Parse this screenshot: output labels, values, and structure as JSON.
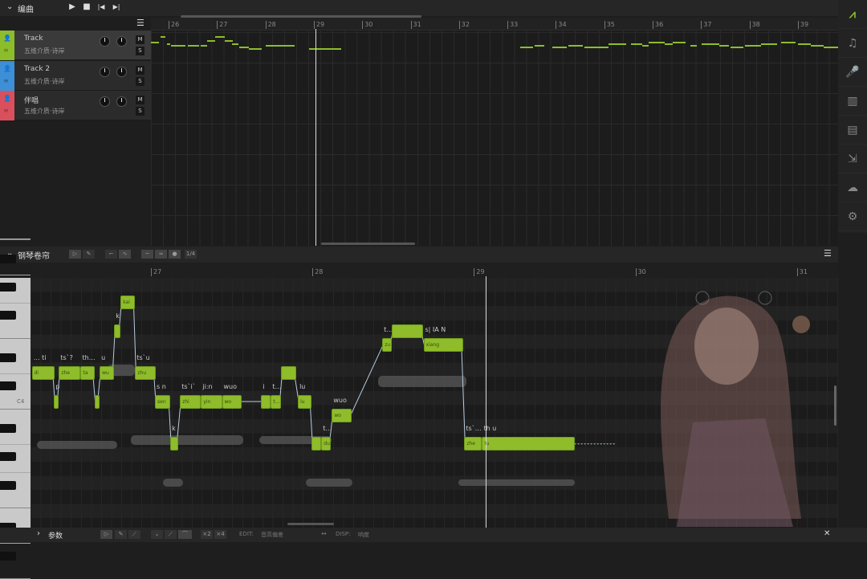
{
  "arrange": {
    "title": "编曲",
    "transport": [
      "▶",
      "■",
      "|◀",
      "▶|"
    ],
    "menu": "☰",
    "ruler": [
      "26",
      "27",
      "28",
      "29",
      "30",
      "31",
      "32",
      "33",
      "34",
      "35",
      "36",
      "37",
      "38",
      "39"
    ],
    "tracks": [
      {
        "name": "Track",
        "singer": "五维介质·诗岸",
        "color": "#8cbd2b",
        "mute": "M",
        "solo": "S"
      },
      {
        "name": "Track 2",
        "singer": "五维介质·诗岸",
        "color": "#3d8fd6",
        "mute": "M",
        "solo": "S"
      },
      {
        "name": "伴唱",
        "singer": "五维介质·诗岸",
        "color": "#d9505c",
        "mute": "M",
        "solo": "S"
      }
    ]
  },
  "sidebar": [
    "logo-icon",
    "music-note-icon",
    "microphone-icon",
    "library-icon",
    "book-icon",
    "export-icon",
    "cloud-icon",
    "settings-icon"
  ],
  "piano_roll": {
    "title": "钢琴卷帘",
    "menu": "☰",
    "quantize": "1/4",
    "ruler": [
      "27",
      "28",
      "29",
      "30",
      "31"
    ],
    "c4_label": "C4",
    "notes": [
      {
        "start": -2.95,
        "len": 0.56,
        "pitch": 62,
        "above": "… ti",
        "inside": "di"
      },
      {
        "start": -2.4,
        "len": 0.12,
        "pitch": 60,
        "above": "p",
        "inside": ""
      },
      {
        "start": -2.28,
        "len": 0.54,
        "pitch": 62,
        "above": "ts`?",
        "inside": "zhe"
      },
      {
        "start": -1.74,
        "len": 0.34,
        "pitch": 62,
        "above": "th…",
        "inside": "ta"
      },
      {
        "start": -1.4,
        "len": 0.12,
        "pitch": 60,
        "above": "",
        "inside": ""
      },
      {
        "start": -1.27,
        "len": 0.36,
        "pitch": 62,
        "above": "u",
        "inside": "wu"
      },
      {
        "start": -0.91,
        "len": 0.16,
        "pitch": 65,
        "above": "k",
        "inside": ""
      },
      {
        "start": -0.75,
        "len": 0.36,
        "pitch": 67,
        "above": "",
        "inside": "kai"
      },
      {
        "start": -0.39,
        "len": 0.5,
        "pitch": 62,
        "above": "ts`u",
        "inside": "zhu"
      },
      {
        "start": 0.1,
        "len": 0.38,
        "pitch": 60,
        "above": "s n",
        "inside": "sen"
      },
      {
        "start": 0.48,
        "len": 0.2,
        "pitch": 57,
        "above": "k",
        "inside": ""
      },
      {
        "start": 0.72,
        "len": 0.52,
        "pitch": 60,
        "above": "ts`i`",
        "inside": "zhi"
      },
      {
        "start": 1.24,
        "len": 0.52,
        "pitch": 60,
        "above": "ji:n",
        "inside": "yin"
      },
      {
        "start": 1.76,
        "len": 0.48,
        "pitch": 60,
        "above": "wuo",
        "inside": "wo"
      },
      {
        "start": 2.73,
        "len": 0.24,
        "pitch": 60,
        "above": "i",
        "inside": ""
      },
      {
        "start": 2.97,
        "len": 0.26,
        "pitch": 60,
        "above": "t…",
        "inside": "t…"
      },
      {
        "start": 3.23,
        "len": 0.36,
        "pitch": 62,
        "above": "",
        "inside": ""
      },
      {
        "start": 3.64,
        "len": 0.34,
        "pitch": 60,
        "above": "lu",
        "inside": "lu"
      },
      {
        "start": 3.98,
        "len": 0.24,
        "pitch": 57,
        "above": "",
        "inside": ""
      },
      {
        "start": 4.22,
        "len": 0.24,
        "pitch": 57,
        "above": "t…",
        "inside": "du"
      },
      {
        "start": 4.48,
        "len": 0.5,
        "pitch": 59,
        "above": "wuo",
        "inside": "wo"
      },
      {
        "start": 5.73,
        "len": 0.24,
        "pitch": 64,
        "above": "t…",
        "inside": "zu"
      },
      {
        "start": 5.97,
        "len": 0.76,
        "pitch": 65,
        "above": "",
        "inside": ""
      },
      {
        "start": 6.75,
        "len": 0.98,
        "pitch": 64,
        "above": "s| IA N",
        "inside": "xiang"
      },
      {
        "start": 7.76,
        "len": 0.44,
        "pitch": 57,
        "above": "ts`…",
        "inside": "zhe"
      },
      {
        "start": 8.2,
        "len": 2.29,
        "pitch": 57,
        "above": "th u",
        "inside": "tu"
      }
    ]
  },
  "bottom": {
    "title": "参数",
    "mult": [
      "×2",
      "×4"
    ],
    "edit_label": "EDIT:",
    "edit_value": "音高偏差",
    "disp_label": "DISP:",
    "disp_value": "响度",
    "close": "✕"
  }
}
